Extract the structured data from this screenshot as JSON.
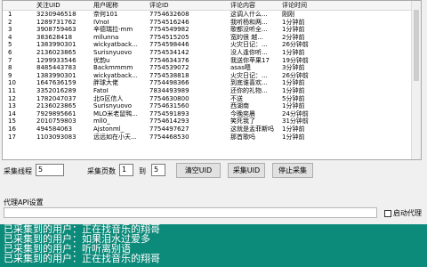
{
  "table": {
    "headers": [
      "",
      "关注UID",
      "用户昵称",
      "评论ID",
      "评论内容",
      "评论时间"
    ],
    "rows": [
      [
        "1",
        "3230946518",
        "奈何101",
        "7754632608",
        "这调入什么...",
        "刚刚"
      ],
      [
        "2",
        "1289731762",
        "IVnoI",
        "7754516246",
        "我听杨和两...",
        "1分钟前"
      ],
      [
        "3",
        "3908759463",
        "辛德瑞拉-mm",
        "7754549982",
        "歌都没听全...",
        "1分钟前"
      ],
      [
        "4",
        "383628418",
        "mllunna",
        "7754515205",
        "宽的很  越...",
        "2分钟前"
      ],
      [
        "5",
        "1383990301",
        "wickyatback...",
        "7754598446",
        "火灾日记：...",
        "26分钟前"
      ],
      [
        "6",
        "2136023865",
        "Surisnyuovo",
        "7754534142",
        "没人逢你听...",
        "1分钟前"
      ],
      [
        "7",
        "1299933546",
        "优韵u",
        "7754634376",
        "我送你苹果17",
        "19分钟前"
      ],
      [
        "8",
        "8485443783",
        "Backmmmm",
        "7754539072",
        "asas嗯",
        "3分钟前"
      ],
      [
        "9",
        "1383990301",
        "wickyatback...",
        "7754538818",
        "火灾日记：...",
        "26分钟前"
      ],
      [
        "10",
        "1647636159",
        "胖球大佬",
        "7754498366",
        "到底谁喜欢...",
        "1分钟前"
      ],
      [
        "11",
        "3352016289",
        "FatoI",
        "7834493989",
        "还你的礼物...",
        "1分钟前"
      ],
      [
        "12",
        "1782047037",
        "北G区信人",
        "7754630800",
        "不送",
        "5分钟前"
      ],
      [
        "13",
        "2136023865",
        "Surisnyuovo",
        "7754631560",
        "西湖南",
        "1分钟前"
      ],
      [
        "14",
        "7929895661",
        "MLO米老鼠鸭...",
        "7754591893",
        "今晚奕晨",
        "24分钟前"
      ],
      [
        "15",
        "2010759803",
        "mll0_",
        "7754614293",
        "笑死我了",
        "31分钟前"
      ],
      [
        "16",
        "494584063",
        "Ajstonml_",
        "7754497627",
        "这就是孟菲斯吗",
        "1分钟前"
      ],
      [
        "17",
        "1103093083",
        "远远如在小天...",
        "7754468530",
        "那首歌吗",
        "1分钟前"
      ]
    ]
  },
  "controls": {
    "threads_label": "采集线程",
    "threads_value": "5",
    "pages_label": "采集页数",
    "pages_from": "1",
    "pages_to_label": "到",
    "pages_to": "5",
    "clear_uid_label": "清空UID",
    "collect_uid_label": "采集UID",
    "stop_label": "停止采集"
  },
  "proxy": {
    "section_label": "代理API设置",
    "enable_label": "启动代理",
    "enabled": false
  },
  "log": {
    "lines": [
      "已采集到的用户：正在找音乐的翔哥",
      "已采集到的用户：如果泪水过爱多",
      "已采集到的用户：听听离别语",
      "已采集到的用户：正在找音乐的翔哥"
    ]
  }
}
